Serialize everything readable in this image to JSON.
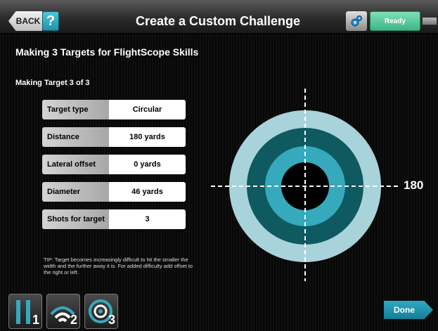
{
  "header": {
    "back_label": "BACK",
    "help_label": "?",
    "title": "Create a Custom Challenge",
    "settings_icon": "gear-icon",
    "ready_label": "Ready",
    "battery_icon": "battery-icon"
  },
  "subtitle": "Making 3 Targets for FlightScope Skills",
  "making_label": "Making Target 3 of 3",
  "fields": [
    {
      "label": "Target type",
      "value": "Circular"
    },
    {
      "label": "Distance",
      "value": "180 yards"
    },
    {
      "label": "Lateral offset",
      "value": "0 yards"
    },
    {
      "label": "Diameter",
      "value": "46 yards"
    },
    {
      "label": "Shots for target",
      "value": "3"
    }
  ],
  "tip": "TIP: Target becomes increasingly difficult to hit the smaller the width and the further away it is. For added difficulty add offset to the right or left.",
  "target": {
    "distance_label": "180",
    "ring_colors": [
      "#a9d3da",
      "#0e5a60",
      "#36a9bd",
      "#000000"
    ]
  },
  "toolbar": {
    "modes": [
      {
        "icon": "parallel-lines-icon",
        "number": "1"
      },
      {
        "icon": "wifi-arc-icon",
        "number": "2"
      },
      {
        "icon": "target-rings-icon",
        "number": "3"
      }
    ],
    "done_label": "Done"
  },
  "colors": {
    "accent": "#1e93a8",
    "ready": "#3cb585"
  }
}
